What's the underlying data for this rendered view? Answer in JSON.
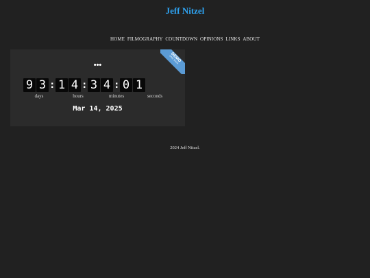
{
  "site": {
    "title": "Jeff Nitzel"
  },
  "nav": {
    "items": [
      {
        "label": "HOME"
      },
      {
        "label": "FILMOGRAPHY"
      },
      {
        "label": "COUNTDOWN"
      },
      {
        "label": "OPINIONS"
      },
      {
        "label": "LINKS"
      },
      {
        "label": "ABOUT"
      }
    ]
  },
  "countdown": {
    "ribbon_title": "DEMO",
    "ribbon_subtitle": "ONE SIGN",
    "more_label": "•••",
    "digits": {
      "d1": "9",
      "d2": "3",
      "h1": "1",
      "h2": "4",
      "m1": "3",
      "m2": "4",
      "s1": "0",
      "s2": "1"
    },
    "separator": ":",
    "units": {
      "days": "days",
      "hours": "hours",
      "minutes": "minutes",
      "seconds": "seconds"
    },
    "target_date": "Mar 14, 2025"
  },
  "footer": {
    "text": "2024 Jeff Nitzel."
  },
  "colors": {
    "background": "#212121",
    "panel": "#2b2b2b",
    "title_accent": "#2ea3f2",
    "ribbon": "#5b9bd5",
    "digit_tile": "#080808"
  }
}
